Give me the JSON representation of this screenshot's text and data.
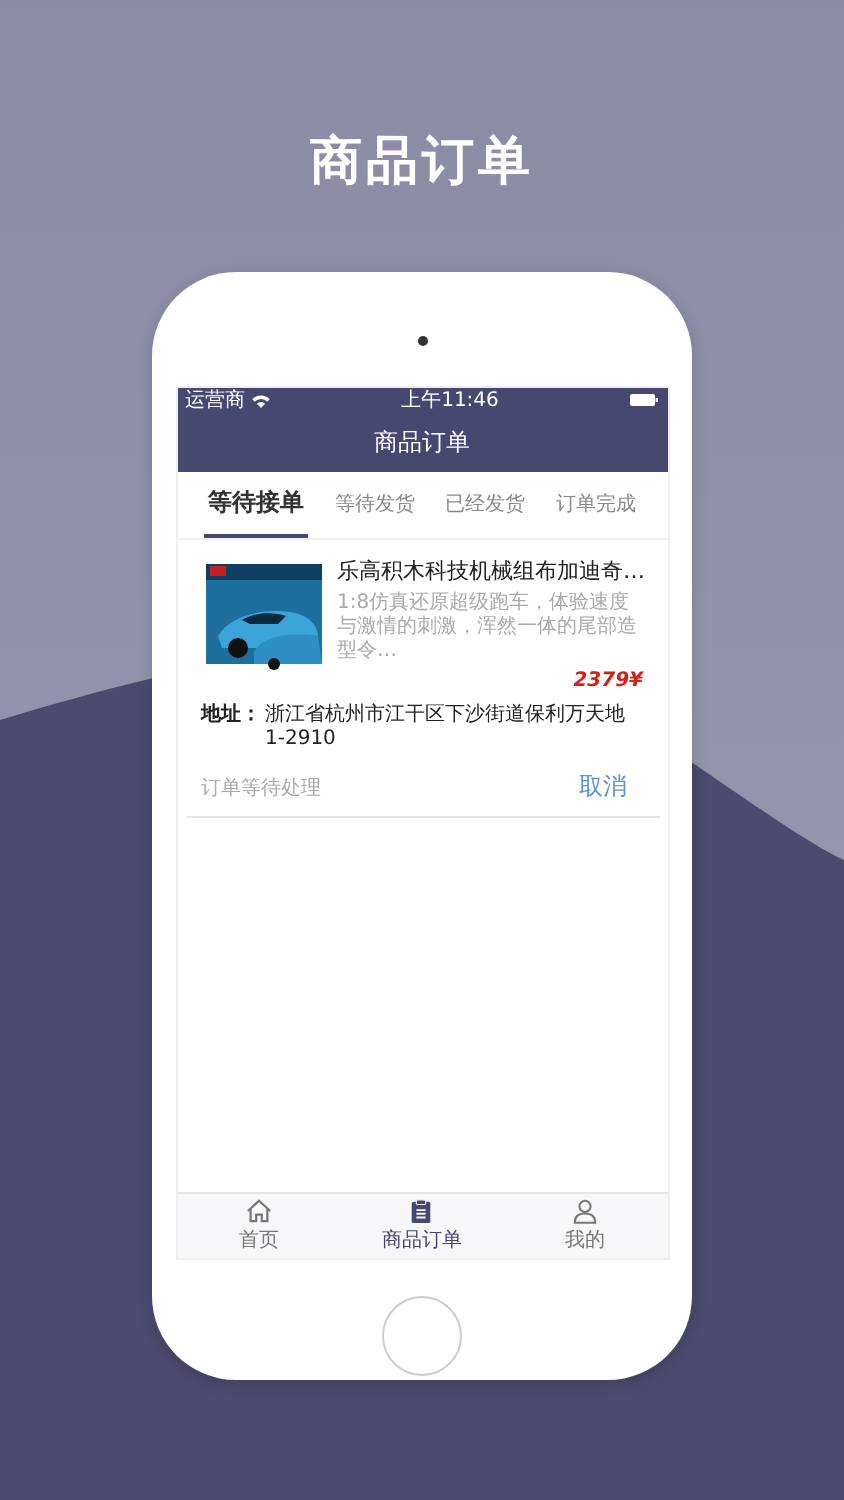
{
  "headline": "商品订单",
  "status_bar": {
    "carrier": "运营商",
    "time": "上午11:46"
  },
  "nav_bar": {
    "title": "商品订单"
  },
  "tabs": [
    {
      "label": "等待接单",
      "selected": true
    },
    {
      "label": "等待发货",
      "selected": false
    },
    {
      "label": "已经发货",
      "selected": false
    },
    {
      "label": "订单完成",
      "selected": false
    }
  ],
  "orders": [
    {
      "title": "乐高积木科技机械组布加迪奇…",
      "description": "1:8仿真还原超级跑车，体验速度与激情的刺激，浑然一体的尾部造型令…",
      "price": "2379¥",
      "address_label": "地址：",
      "address": "浙江省杭州市江干区下沙街道保利万天地1-2910",
      "status": "订单等待处理",
      "action": "取消"
    }
  ],
  "tab_bar": [
    {
      "label": "首页",
      "kind": "home",
      "selected": false
    },
    {
      "label": "商品订单",
      "kind": "clipboard",
      "selected": true
    },
    {
      "label": "我的",
      "kind": "person",
      "selected": false
    }
  ]
}
